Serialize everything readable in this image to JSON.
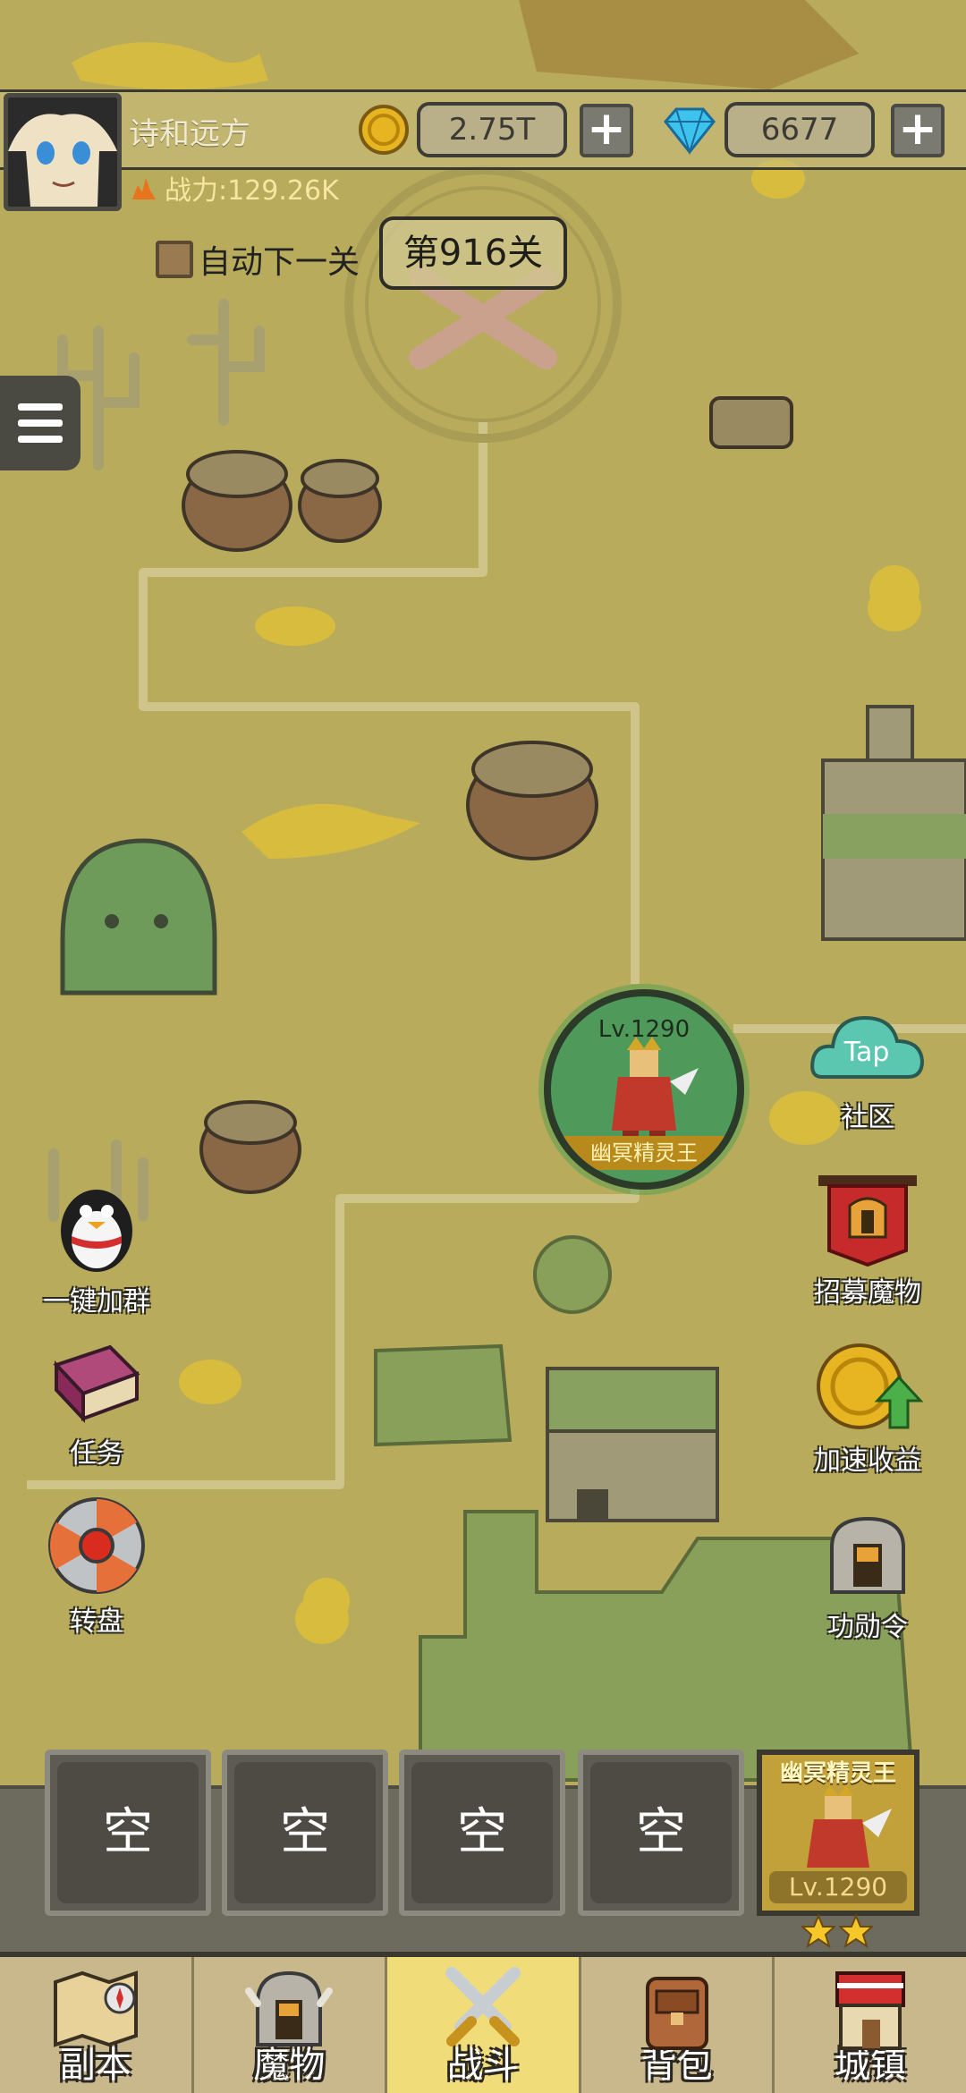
{
  "player": {
    "name": "诗和远方",
    "power_label": "战力:129.26K"
  },
  "currency": {
    "gold": "2.75T",
    "gems": "6677",
    "plus": "+"
  },
  "stage": {
    "auto_next_label": "自动下一关",
    "stage_label": "第916关"
  },
  "boss": {
    "level": "Lv.1290",
    "name": "幽冥精灵王"
  },
  "side_buttons": {
    "left": [
      {
        "label": "一键加群",
        "icon": "penguin-icon"
      },
      {
        "label": "任务",
        "icon": "book-icon"
      },
      {
        "label": "转盘",
        "icon": "wheel-icon"
      }
    ],
    "right": [
      {
        "label": "社区",
        "icon": "taptap-cloud-icon",
        "badge": "Tap"
      },
      {
        "label": "招募魔物",
        "icon": "banner-helmet-icon"
      },
      {
        "label": "加速收益",
        "icon": "coin-arrow-icon"
      },
      {
        "label": "功勋令",
        "icon": "knight-helmet-icon"
      }
    ]
  },
  "team": {
    "empty_label": "空",
    "hero": {
      "name": "幽冥精灵王",
      "level": "Lv.1290",
      "stars": 2
    }
  },
  "nav": {
    "tabs": [
      {
        "label": "副本",
        "icon": "map-icon",
        "active": false
      },
      {
        "label": "魔物",
        "icon": "helmet-icon",
        "active": false
      },
      {
        "label": "战斗",
        "icon": "crossed-swords-icon",
        "active": true
      },
      {
        "label": "背包",
        "icon": "backpack-icon",
        "active": false
      },
      {
        "label": "城镇",
        "icon": "shop-icon",
        "active": false
      }
    ]
  },
  "colors": {
    "map_bg": "#b8ab5c",
    "active_tab": "#f1dc7a",
    "boss_ring": "#4f9a5a"
  }
}
